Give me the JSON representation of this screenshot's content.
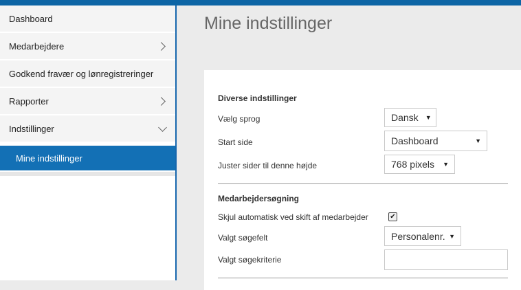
{
  "sidebar": {
    "items": [
      {
        "label": "Dashboard"
      },
      {
        "label": "Medarbejdere"
      },
      {
        "label": "Godkend fravær og lønregistreringer"
      },
      {
        "label": "Rapporter"
      },
      {
        "label": "Indstillinger"
      }
    ],
    "active_sub_item": {
      "label": "Mine indstillinger"
    }
  },
  "page": {
    "title": "Mine indstillinger"
  },
  "section_misc": {
    "title": "Diverse indstillinger",
    "language_label": "Vælg sprog",
    "language_value": "Dansk",
    "start_page_label": "Start side",
    "start_page_value": "Dashboard",
    "height_label": "Juster sider til denne højde",
    "height_value": "768 pixels"
  },
  "section_employee_search": {
    "title": "Medarbejdersøgning",
    "auto_hide_label": "Skjul automatisk ved skift af medarbejder",
    "auto_hide_checked": true,
    "search_field_label": "Valgt søgefelt",
    "search_field_value": "Personalenr.",
    "search_criteria_label": "Valgt søgekriterie",
    "search_criteria_value": ""
  },
  "colors": {
    "accent": "#1370b5",
    "topbar": "#0d65a5",
    "background": "#ebebeb"
  }
}
